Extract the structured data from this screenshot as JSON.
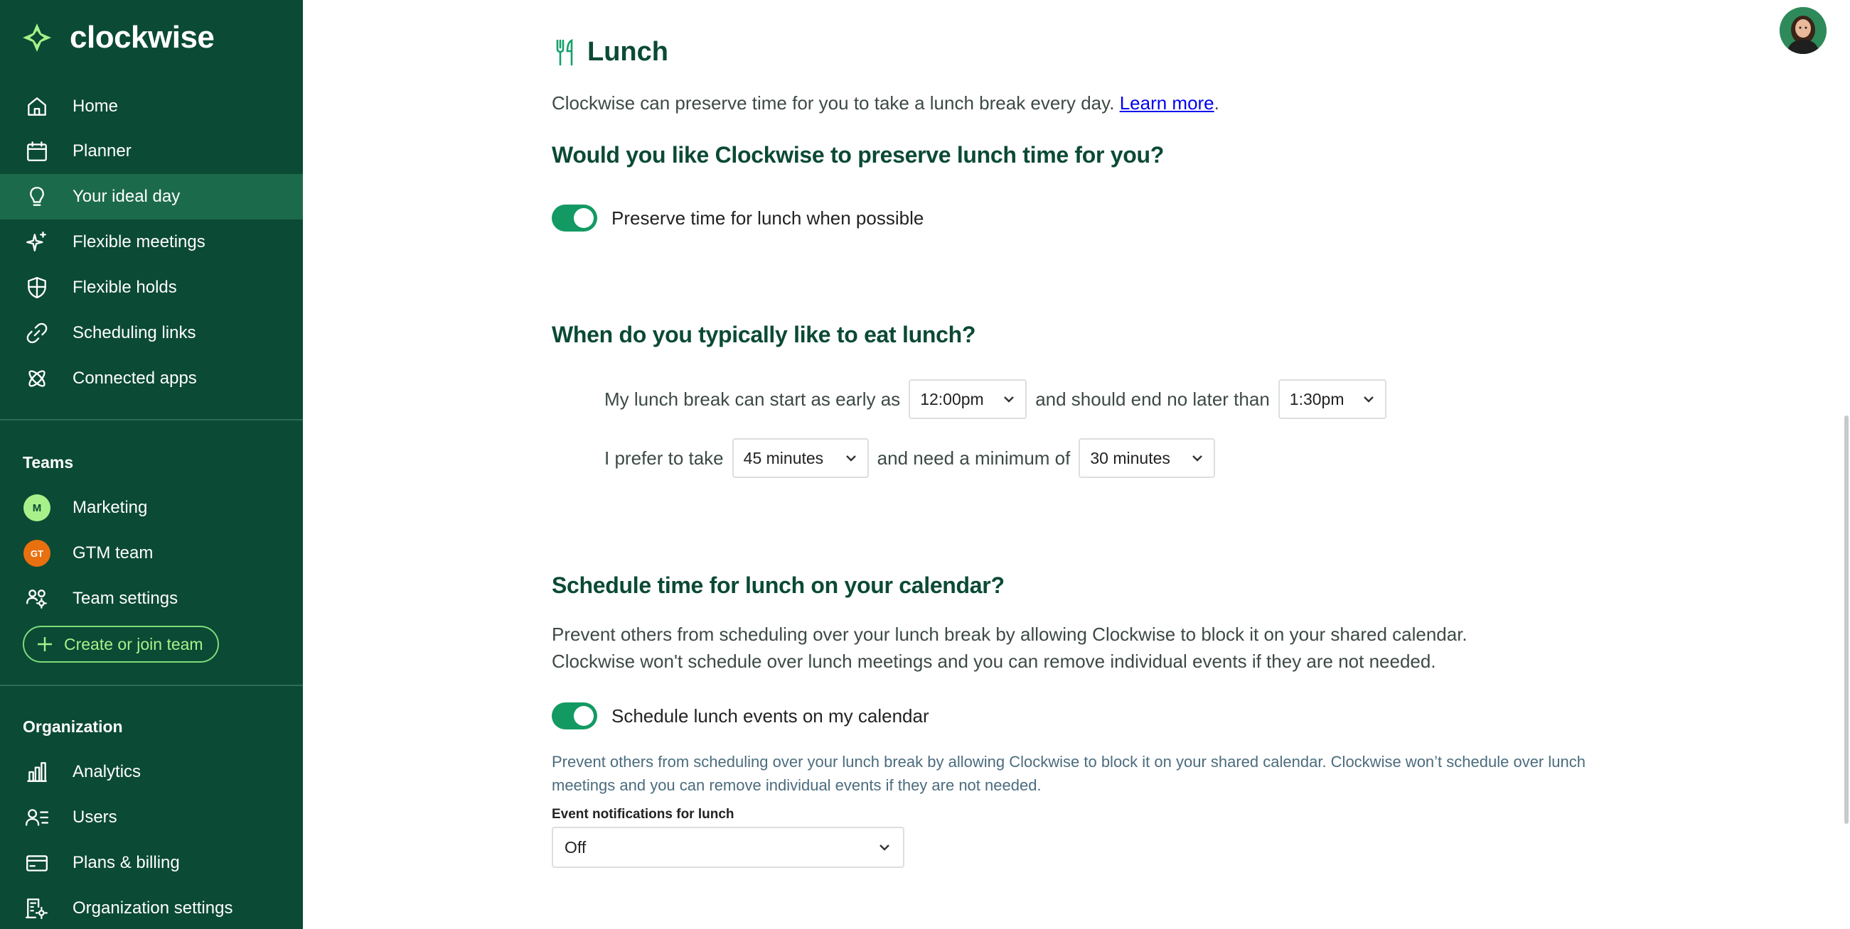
{
  "brand": {
    "name": "clockwise"
  },
  "nav": [
    {
      "label": "Home",
      "icon": "home-icon"
    },
    {
      "label": "Planner",
      "icon": "calendar-icon"
    },
    {
      "label": "Your ideal day",
      "icon": "lightbulb-icon",
      "active": true
    },
    {
      "label": "Flexible meetings",
      "icon": "sparkle-icon"
    },
    {
      "label": "Flexible holds",
      "icon": "shield-icon"
    },
    {
      "label": "Scheduling links",
      "icon": "link-icon"
    },
    {
      "label": "Connected apps",
      "icon": "atom-icon"
    }
  ],
  "teams": {
    "title": "Teams",
    "items": [
      {
        "label": "Marketing",
        "badge": "M",
        "badge_color": "#a8f08a",
        "badge_text_color": "#0b4a34"
      },
      {
        "label": "GTM team",
        "badge": "GT",
        "badge_color": "#e8700f",
        "badge_text_color": "#ffffff"
      }
    ],
    "settings_label": "Team settings",
    "create_label": "Create or join team"
  },
  "organization": {
    "title": "Organization",
    "items": [
      {
        "label": "Analytics",
        "icon": "bar-chart-icon"
      },
      {
        "label": "Users",
        "icon": "users-list-icon"
      },
      {
        "label": "Plans & billing",
        "icon": "credit-card-icon"
      },
      {
        "label": "Organization settings",
        "icon": "org-settings-icon"
      }
    ]
  },
  "page": {
    "title": "Lunch",
    "intro": "Clockwise can preserve time for you to take a lunch break every day.",
    "learn_more": "Learn more",
    "intro_end": ".",
    "q1": "Would you like Clockwise to preserve lunch time for you?",
    "toggle1_label": "Preserve time for lunch when possible",
    "q2": "When do you typically like to eat lunch?",
    "row1_a": "My lunch break can start as early as",
    "row1_start": "12:00pm",
    "row1_b": "and should end no later than",
    "row1_end": "1:30pm",
    "row2_a": "I prefer to take",
    "row2_pref": "45 minutes",
    "row2_b": "and need a minimum of",
    "row2_min": "30 minutes",
    "q3": "Schedule time for lunch on your calendar?",
    "calendar_para_1": "Prevent others from scheduling over your lunch break by allowing Clockwise to block it on your shared calendar.",
    "calendar_para_2": "Clockwise won't schedule over lunch meetings and you can remove individual events if they are not needed.",
    "toggle2_label": "Schedule lunch events on my calendar",
    "helper_text": "Prevent others from scheduling over your lunch break by allowing Clockwise to block it on your shared calendar. Clockwise won’t schedule over lunch meetings and you can remove individual events if they are not needed.",
    "notifications_label": "Event notifications for lunch",
    "notifications_value": "Off"
  }
}
